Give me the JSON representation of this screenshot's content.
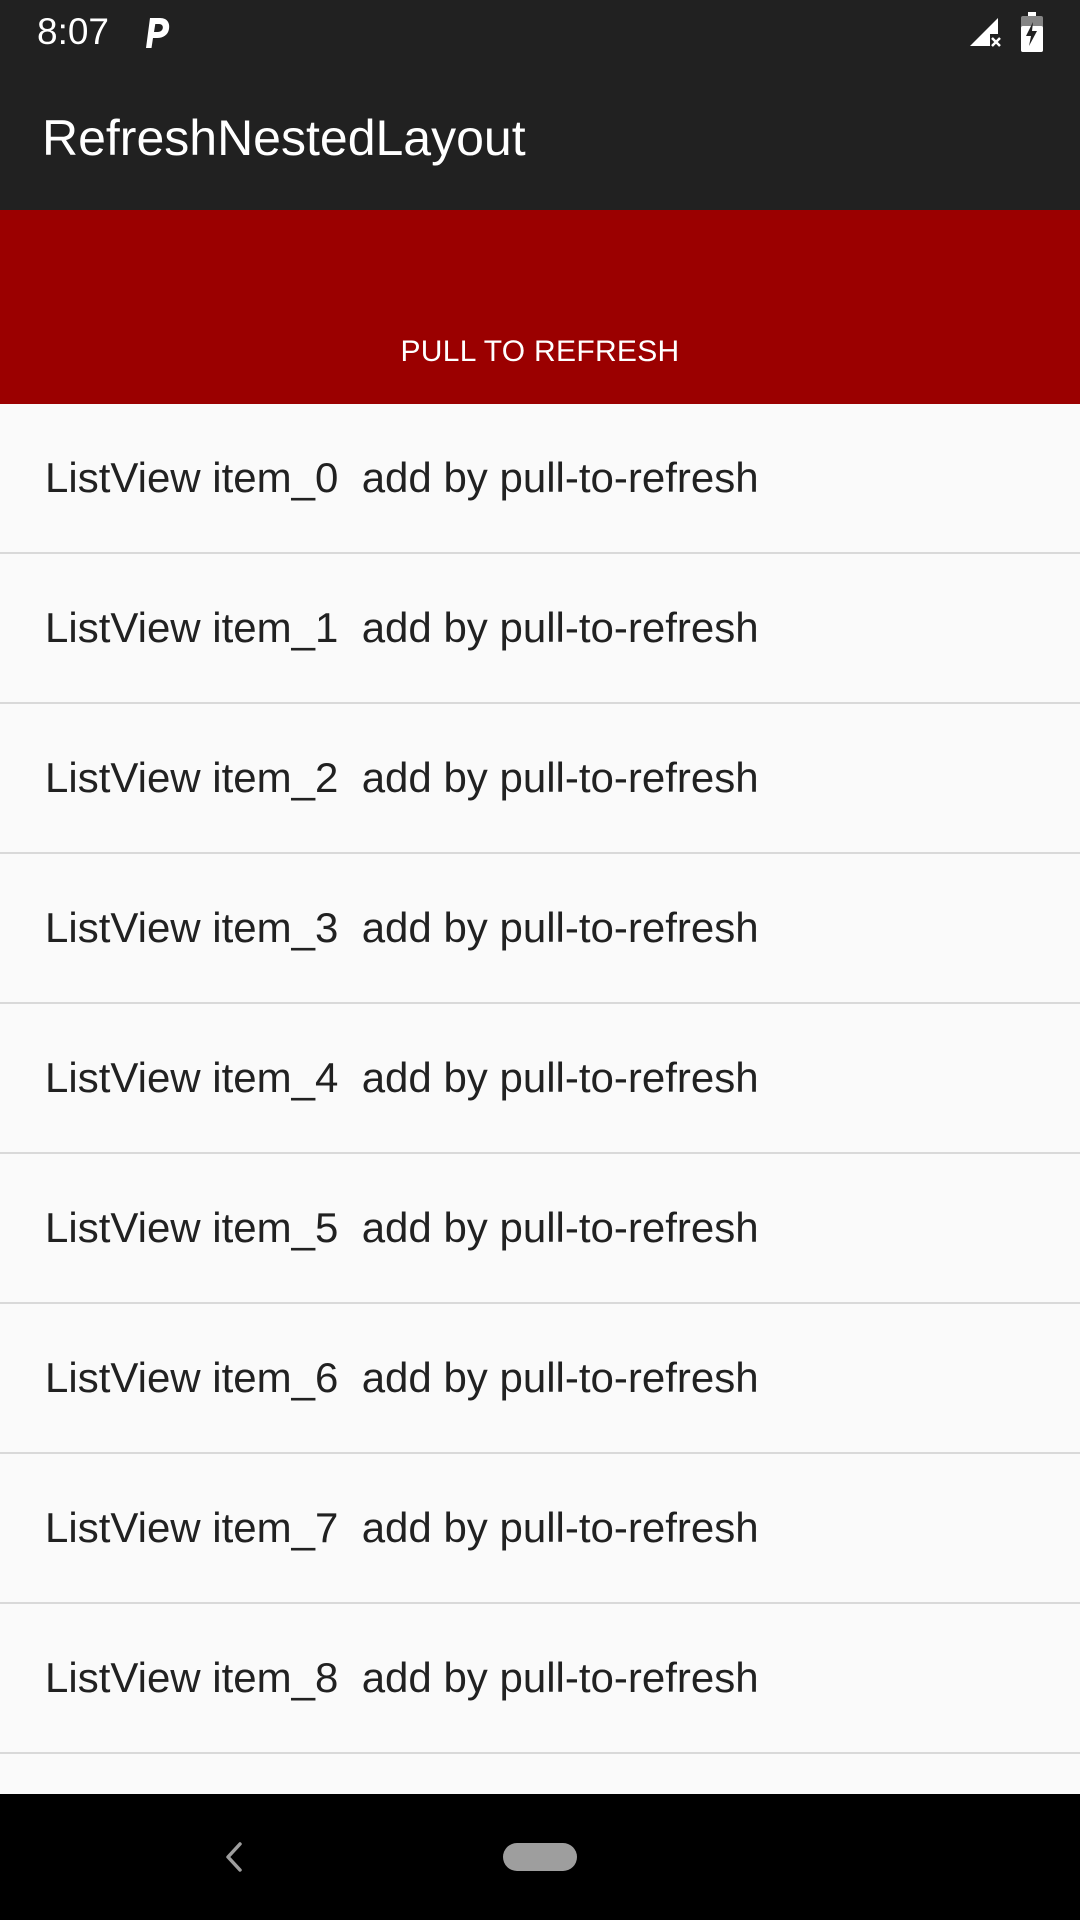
{
  "status_bar": {
    "time": "8:07",
    "icons": [
      "parking-icon",
      "signal-off-icon",
      "battery-charging-icon"
    ]
  },
  "app_bar": {
    "title": "RefreshNestedLayout"
  },
  "refresh_header": {
    "label": "PULL TO REFRESH",
    "background_color": "#9b0000"
  },
  "list": {
    "items": [
      {
        "label": "ListView item_0  add by pull-to-refresh"
      },
      {
        "label": "ListView item_1  add by pull-to-refresh"
      },
      {
        "label": "ListView item_2  add by pull-to-refresh"
      },
      {
        "label": "ListView item_3  add by pull-to-refresh"
      },
      {
        "label": "ListView item_4  add by pull-to-refresh"
      },
      {
        "label": "ListView item_5  add by pull-to-refresh"
      },
      {
        "label": "ListView item_6  add by pull-to-refresh"
      },
      {
        "label": "ListView item_7  add by pull-to-refresh"
      },
      {
        "label": "ListView item_8  add by pull-to-refresh"
      },
      {
        "label": ""
      }
    ]
  },
  "nav_bar": {
    "icons": [
      "back-icon",
      "home-pill-icon"
    ]
  },
  "colors": {
    "bar_background": "#212121",
    "accent_red": "#9b0000",
    "list_background": "#fafafa",
    "divider": "#d9d9d9"
  }
}
